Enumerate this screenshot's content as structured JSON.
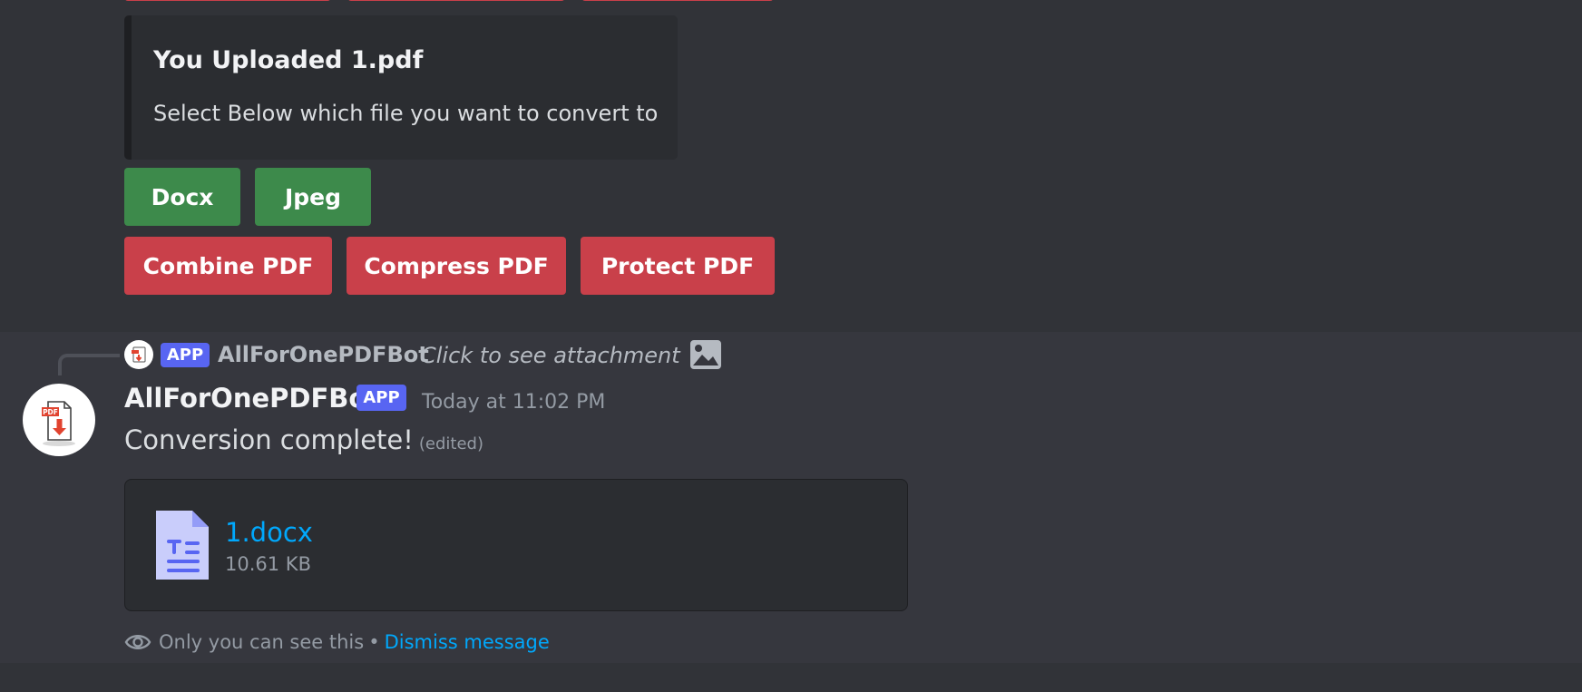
{
  "embed": {
    "title": "You Uploaded 1.pdf",
    "description": "Select Below which file you want to convert to"
  },
  "convert_buttons": {
    "docx": "Docx",
    "jpeg": "Jpeg"
  },
  "pdf_buttons": {
    "combine": "Combine PDF",
    "compress": "Compress PDF",
    "protect": "Protect PDF"
  },
  "reply": {
    "badge": "APP",
    "author": "AllForOnePDFBot",
    "preview": "Click to see attachment",
    "icon": "image-icon"
  },
  "message": {
    "author": "AllForOnePDFBot",
    "badge": "APP",
    "timestamp": "Today at 11:02 PM",
    "text": "Conversion complete!",
    "edited": "(edited)",
    "avatar_icon": "pdf-download-icon"
  },
  "attachment": {
    "file_name": "1.docx",
    "file_size": "10.61 KB",
    "icon": "document-icon"
  },
  "ephemeral": {
    "notice": "Only you can see this",
    "separator": "•",
    "dismiss": "Dismiss message",
    "icon": "eye-icon"
  },
  "colors": {
    "background": "#313338",
    "green_button": "#3d8a4b",
    "red_button": "#c9404a",
    "blurple": "#5865f2",
    "link": "#00a8fc"
  }
}
